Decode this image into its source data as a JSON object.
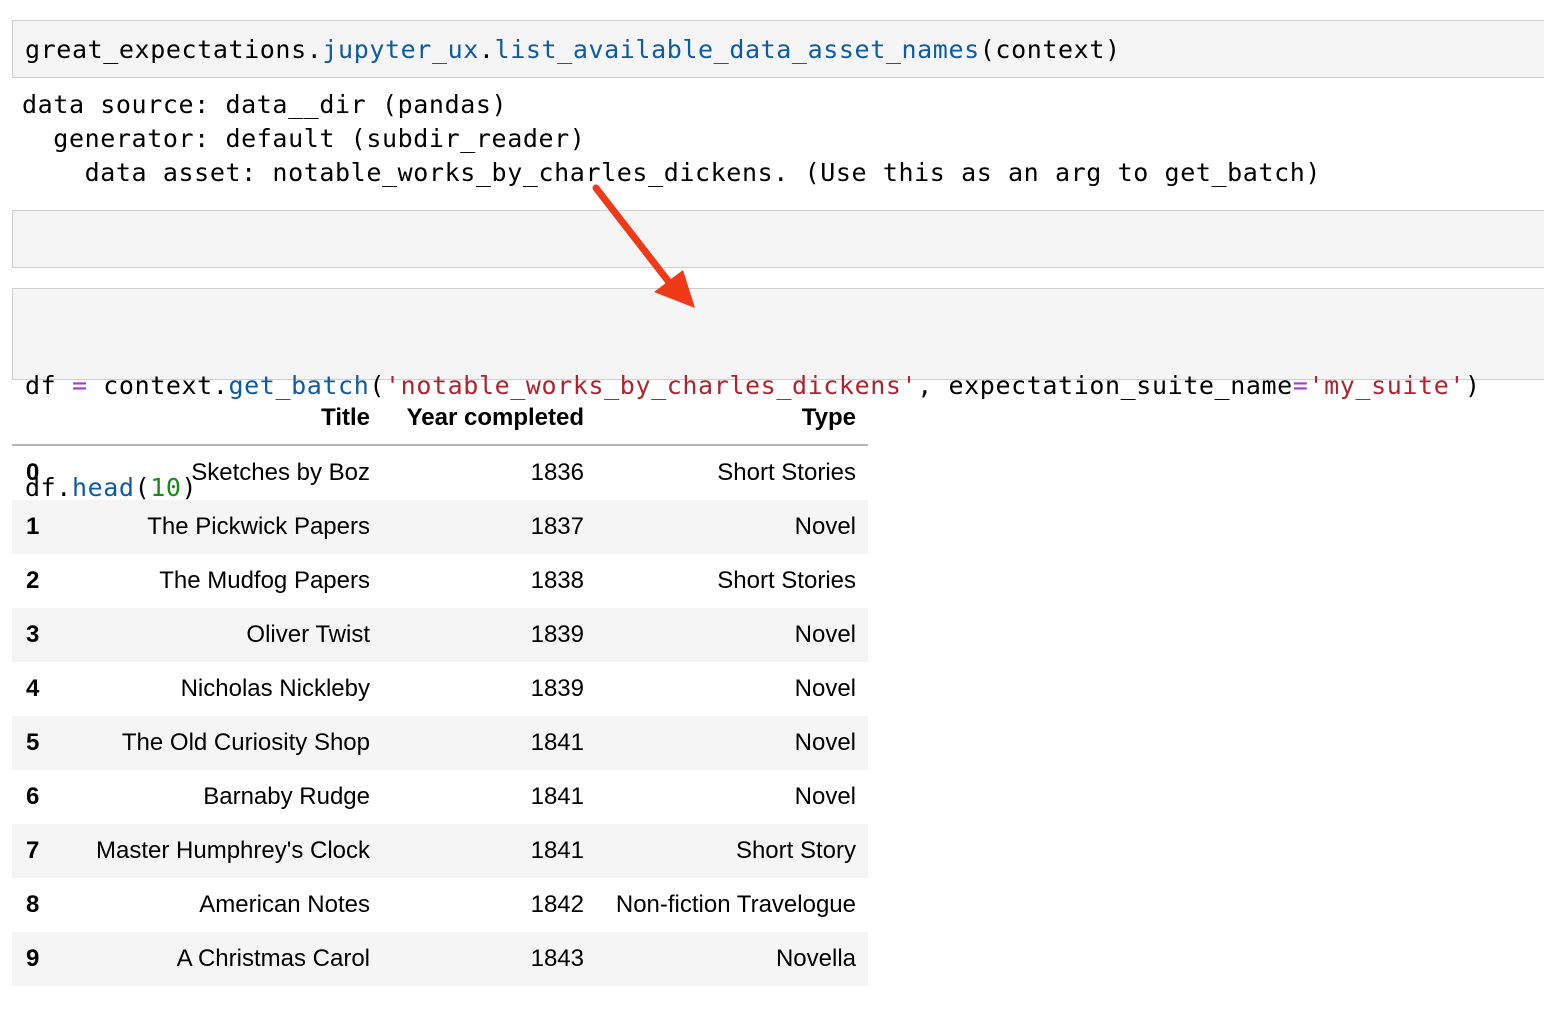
{
  "cell1": {
    "tokens": [
      {
        "t": "great_expectations",
        "c": "name"
      },
      {
        "t": ".",
        "c": "name"
      },
      {
        "t": "jupyter_ux",
        "c": "attr"
      },
      {
        "t": ".",
        "c": "name"
      },
      {
        "t": "list_available_data_asset_names",
        "c": "attr"
      },
      {
        "t": "(context)",
        "c": "name"
      }
    ]
  },
  "output1": {
    "lines": [
      "data source: data__dir (pandas)",
      "  generator: default (subdir_reader)",
      "    data asset: notable_works_by_charles_dickens. (Use this as an arg to get_batch)"
    ]
  },
  "cell3": {
    "line1": [
      {
        "t": "df ",
        "c": "name"
      },
      {
        "t": "=",
        "c": "op"
      },
      {
        "t": " context.",
        "c": "name"
      },
      {
        "t": "get_batch",
        "c": "attr"
      },
      {
        "t": "(",
        "c": "name"
      },
      {
        "t": "'notable_works_by_charles_dickens'",
        "c": "str"
      },
      {
        "t": ", expectation_suite_name",
        "c": "name"
      },
      {
        "t": "=",
        "c": "op"
      },
      {
        "t": "'my_suite'",
        "c": "str"
      },
      {
        "t": ")",
        "c": "name"
      }
    ],
    "line2": [
      {
        "t": "df.",
        "c": "name"
      },
      {
        "t": "head",
        "c": "attr"
      },
      {
        "t": "(",
        "c": "name"
      },
      {
        "t": "10",
        "c": "num"
      },
      {
        "t": ")",
        "c": "name"
      }
    ]
  },
  "dataframe": {
    "columns": [
      "Title",
      "Year completed",
      "Type"
    ],
    "rows": [
      {
        "idx": "0",
        "title": "Sketches by Boz",
        "year": "1836",
        "type": "Short Stories"
      },
      {
        "idx": "1",
        "title": "The Pickwick Papers",
        "year": "1837",
        "type": "Novel"
      },
      {
        "idx": "2",
        "title": "The Mudfog Papers",
        "year": "1838",
        "type": "Short Stories"
      },
      {
        "idx": "3",
        "title": "Oliver Twist",
        "year": "1839",
        "type": "Novel"
      },
      {
        "idx": "4",
        "title": "Nicholas Nickleby",
        "year": "1839",
        "type": "Novel"
      },
      {
        "idx": "5",
        "title": "The Old Curiosity Shop",
        "year": "1841",
        "type": "Novel"
      },
      {
        "idx": "6",
        "title": "Barnaby Rudge",
        "year": "1841",
        "type": "Novel"
      },
      {
        "idx": "7",
        "title": "Master Humphrey's Clock",
        "year": "1841",
        "type": "Short Story"
      },
      {
        "idx": "8",
        "title": "American Notes",
        "year": "1842",
        "type": "Non-fiction Travelogue"
      },
      {
        "idx": "9",
        "title": "A Christmas Carol",
        "year": "1843",
        "type": "Novella"
      }
    ]
  },
  "colors": {
    "attr": "#0c5ba4",
    "operator": "#a33dc7",
    "string": "#b2222c",
    "number": "#1a8a1a",
    "arrow": "#f03a17",
    "cell_bg": "#f5f5f5"
  }
}
